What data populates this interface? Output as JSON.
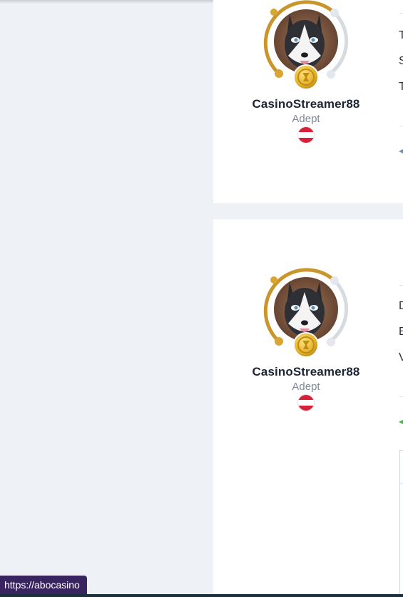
{
  "posts": [
    {
      "author": {
        "username": "CasinoStreamer88",
        "rank": "Adept",
        "flag": "Austria"
      },
      "text_lines": [
        "T",
        "S",
        "T"
      ],
      "reply_icon": "quote-arrow-icon",
      "reply_color": "#7a8ea3"
    },
    {
      "author": {
        "username": "CasinoStreamer88",
        "rank": "Adept",
        "flag": "Austria"
      },
      "text_lines": [
        "D",
        "E",
        "V"
      ],
      "reply_icon": "quote-arrow-icon",
      "reply_color": "#4caf50"
    }
  ],
  "status_bar": {
    "url": "https://abocasino"
  },
  "colors": {
    "page_bg": "#eef1f6",
    "card_bg": "#ffffff",
    "ring_gold": "#c8962a",
    "ring_track": "#d6dbe2",
    "medal_gold": "#e2b023",
    "flag_red": "#d8203a",
    "status_bg": "#3a2460"
  }
}
